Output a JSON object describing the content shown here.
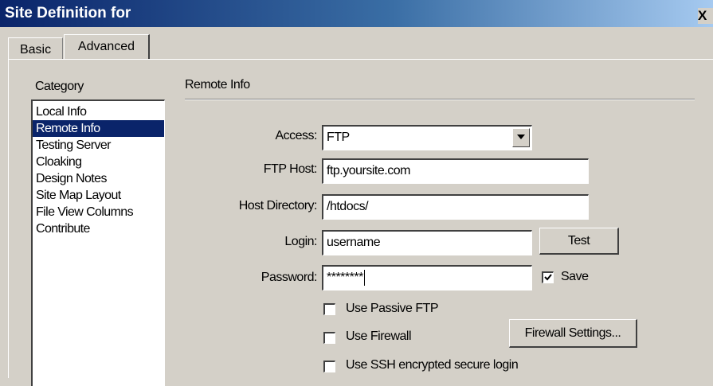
{
  "window": {
    "title": "Site Definition for",
    "close_label": "X"
  },
  "tabs": [
    {
      "label": "Basic",
      "active": false
    },
    {
      "label": "Advanced",
      "active": true
    }
  ],
  "category": {
    "label": "Category",
    "items": [
      "Local Info",
      "Remote Info",
      "Testing Server",
      "Cloaking",
      "Design Notes",
      "Site Map Layout",
      "File View Columns",
      "Contribute"
    ],
    "selected_index": 1
  },
  "remote_info": {
    "section_title": "Remote Info",
    "access": {
      "label": "Access:",
      "value": "FTP",
      "arrow_icon": "dropdown-arrow-icon"
    },
    "ftp_host": {
      "label": "FTP Host:",
      "value": "ftp.yoursite.com"
    },
    "host_directory": {
      "label": "Host Directory:",
      "value": "/htdocs/"
    },
    "login": {
      "label": "Login:",
      "value": "username"
    },
    "test_button": "Test",
    "password": {
      "label": "Password:",
      "value": "********"
    },
    "save": {
      "label": "Save",
      "checked": true
    },
    "passive_ftp": {
      "label": "Use Passive FTP",
      "checked": false
    },
    "firewall": {
      "label": "Use Firewall",
      "checked": false
    },
    "firewall_settings_button": "Firewall Settings...",
    "ssh": {
      "label": "Use SSH encrypted secure login",
      "checked": false
    }
  }
}
